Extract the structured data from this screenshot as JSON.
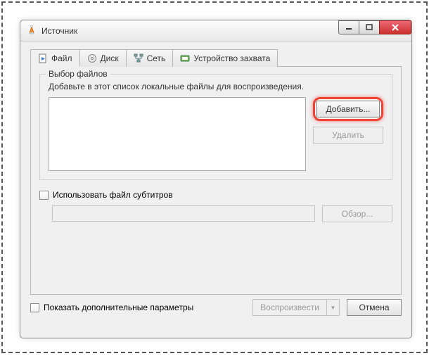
{
  "window": {
    "title": "Источник"
  },
  "tabs": [
    {
      "label": "Файл"
    },
    {
      "label": "Диск"
    },
    {
      "label": "Сеть"
    },
    {
      "label": "Устройство захвата"
    }
  ],
  "fileGroup": {
    "title": "Выбор файлов",
    "description": "Добавьте в этот список локальные файлы для воспроизведения.",
    "addLabel": "Добавить...",
    "removeLabel": "Удалить"
  },
  "subtitle": {
    "useLabel": "Использовать файл субтитров",
    "browseLabel": "Обзор..."
  },
  "footer": {
    "moreOptionsLabel": "Показать дополнительные параметры",
    "playLabel": "Воспроизвести",
    "cancelLabel": "Отмена"
  }
}
